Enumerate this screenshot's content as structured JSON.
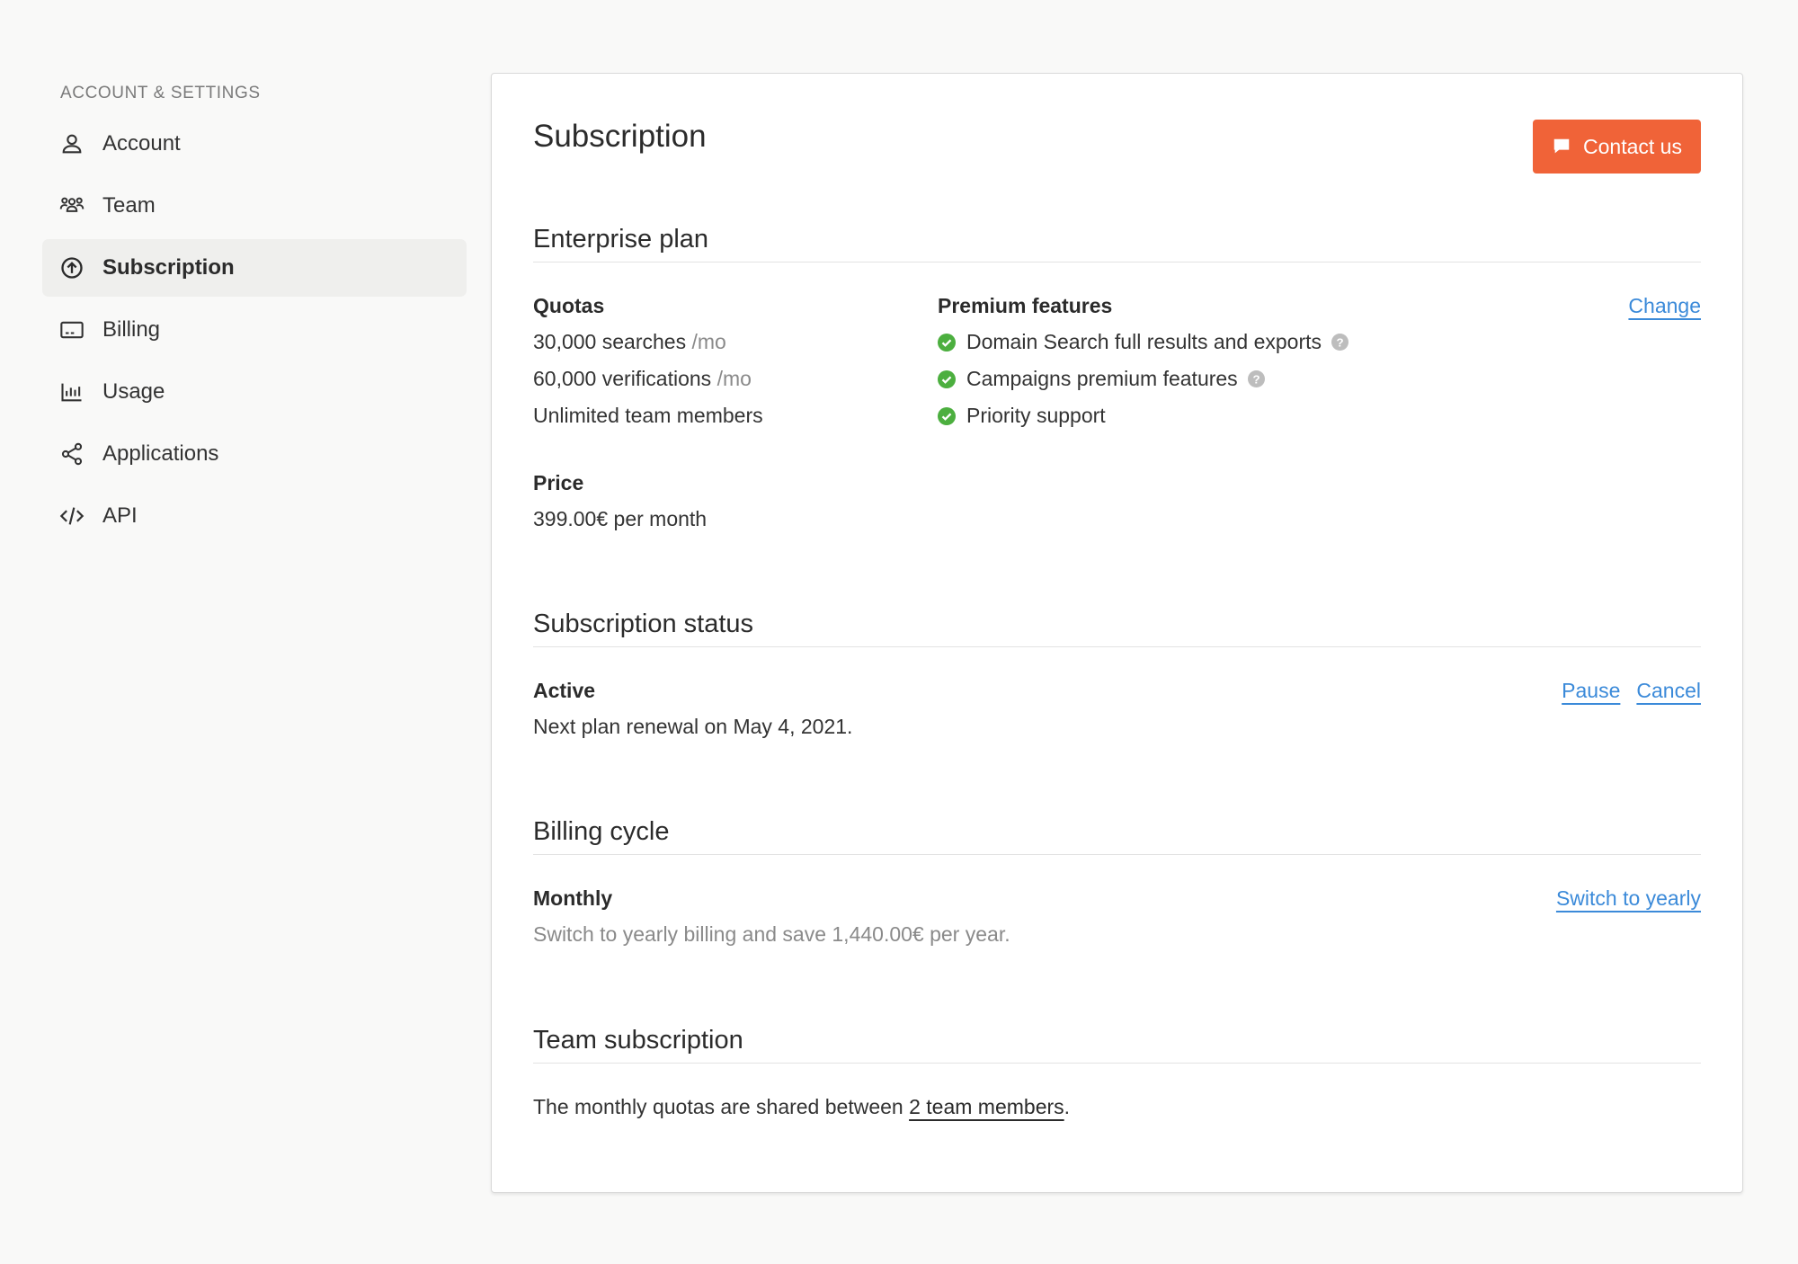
{
  "sidebar": {
    "heading": "ACCOUNT & SETTINGS",
    "items": [
      {
        "label": "Account",
        "icon": "user-icon",
        "active": false
      },
      {
        "label": "Team",
        "icon": "team-icon",
        "active": false
      },
      {
        "label": "Subscription",
        "icon": "arrow-up-circle-icon",
        "active": true
      },
      {
        "label": "Billing",
        "icon": "card-icon",
        "active": false
      },
      {
        "label": "Usage",
        "icon": "bar-chart-icon",
        "active": false
      },
      {
        "label": "Applications",
        "icon": "share-icon",
        "active": false
      },
      {
        "label": "API",
        "icon": "code-icon",
        "active": false
      }
    ]
  },
  "main": {
    "title": "Subscription",
    "contact_label": "Contact us",
    "plan": {
      "title": "Enterprise plan",
      "quotas_label": "Quotas",
      "quotas": [
        {
          "value": "30,000 searches",
          "unit": "/mo"
        },
        {
          "value": "60,000 verifications",
          "unit": "/mo"
        },
        {
          "value": "Unlimited team members",
          "unit": ""
        }
      ],
      "features_label": "Premium features",
      "features": [
        {
          "label": "Domain Search full results and exports",
          "help": true
        },
        {
          "label": "Campaigns premium features",
          "help": true
        },
        {
          "label": "Priority support",
          "help": false
        }
      ],
      "change_label": "Change",
      "price_label": "Price",
      "price_value": "399.00€ per month"
    },
    "status": {
      "title": "Subscription status",
      "label": "Active",
      "text": "Next plan renewal on May 4, 2021.",
      "pause_label": "Pause",
      "cancel_label": "Cancel"
    },
    "billing": {
      "title": "Billing cycle",
      "label": "Monthly",
      "text": "Switch to yearly billing and save 1,440.00€ per year.",
      "switch_label": "Switch to yearly"
    },
    "team": {
      "title": "Team subscription",
      "text_before": "The monthly quotas are shared between ",
      "link_label": "2 team members",
      "text_after": "."
    }
  },
  "colors": {
    "accent": "#f06338",
    "link": "#3b8ad9",
    "check": "#4caf3f",
    "active_bg": "#efefed",
    "page_bg": "#f9f9f8"
  }
}
